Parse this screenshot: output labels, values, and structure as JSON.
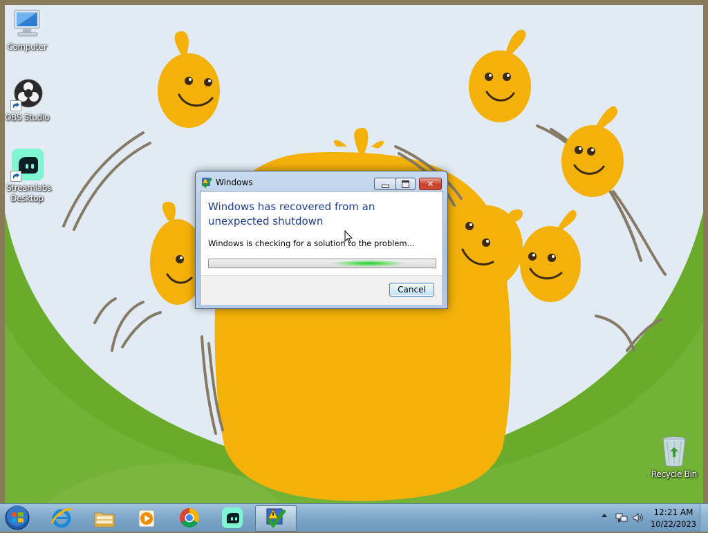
{
  "desktop_icons": [
    {
      "label": "Computer",
      "icon": "computer-icon"
    },
    {
      "label": "OBS Studio",
      "icon": "obs-studio-icon"
    },
    {
      "label": "Streamlabs Desktop",
      "icon": "streamlabs-icon"
    },
    {
      "label": "Recycle Bin",
      "icon": "recycle-bin-icon"
    }
  ],
  "dialog": {
    "title": "Windows",
    "heading": "Windows has recovered from an unexpected shutdown",
    "message": "Windows is checking for a solution to the problem...",
    "progress_style": "marquee",
    "cancel_label": "Cancel"
  },
  "taskbar": {
    "items": [
      {
        "icon": "start-orb-icon"
      },
      {
        "icon": "internet-explorer-icon"
      },
      {
        "icon": "file-explorer-icon"
      },
      {
        "icon": "media-player-icon"
      },
      {
        "icon": "chrome-icon"
      },
      {
        "icon": "streamlabs-icon"
      },
      {
        "icon": "problem-reports-icon",
        "active": true
      }
    ],
    "clock_time": "12:21 AM",
    "clock_date": "10/22/2023"
  },
  "colors": {
    "heading": "#1e3f8f",
    "wallpaper_sky": "#e2ebf3",
    "wallpaper_hill": "#6aab2c",
    "wallpaper_blob": "#f4b10a"
  }
}
